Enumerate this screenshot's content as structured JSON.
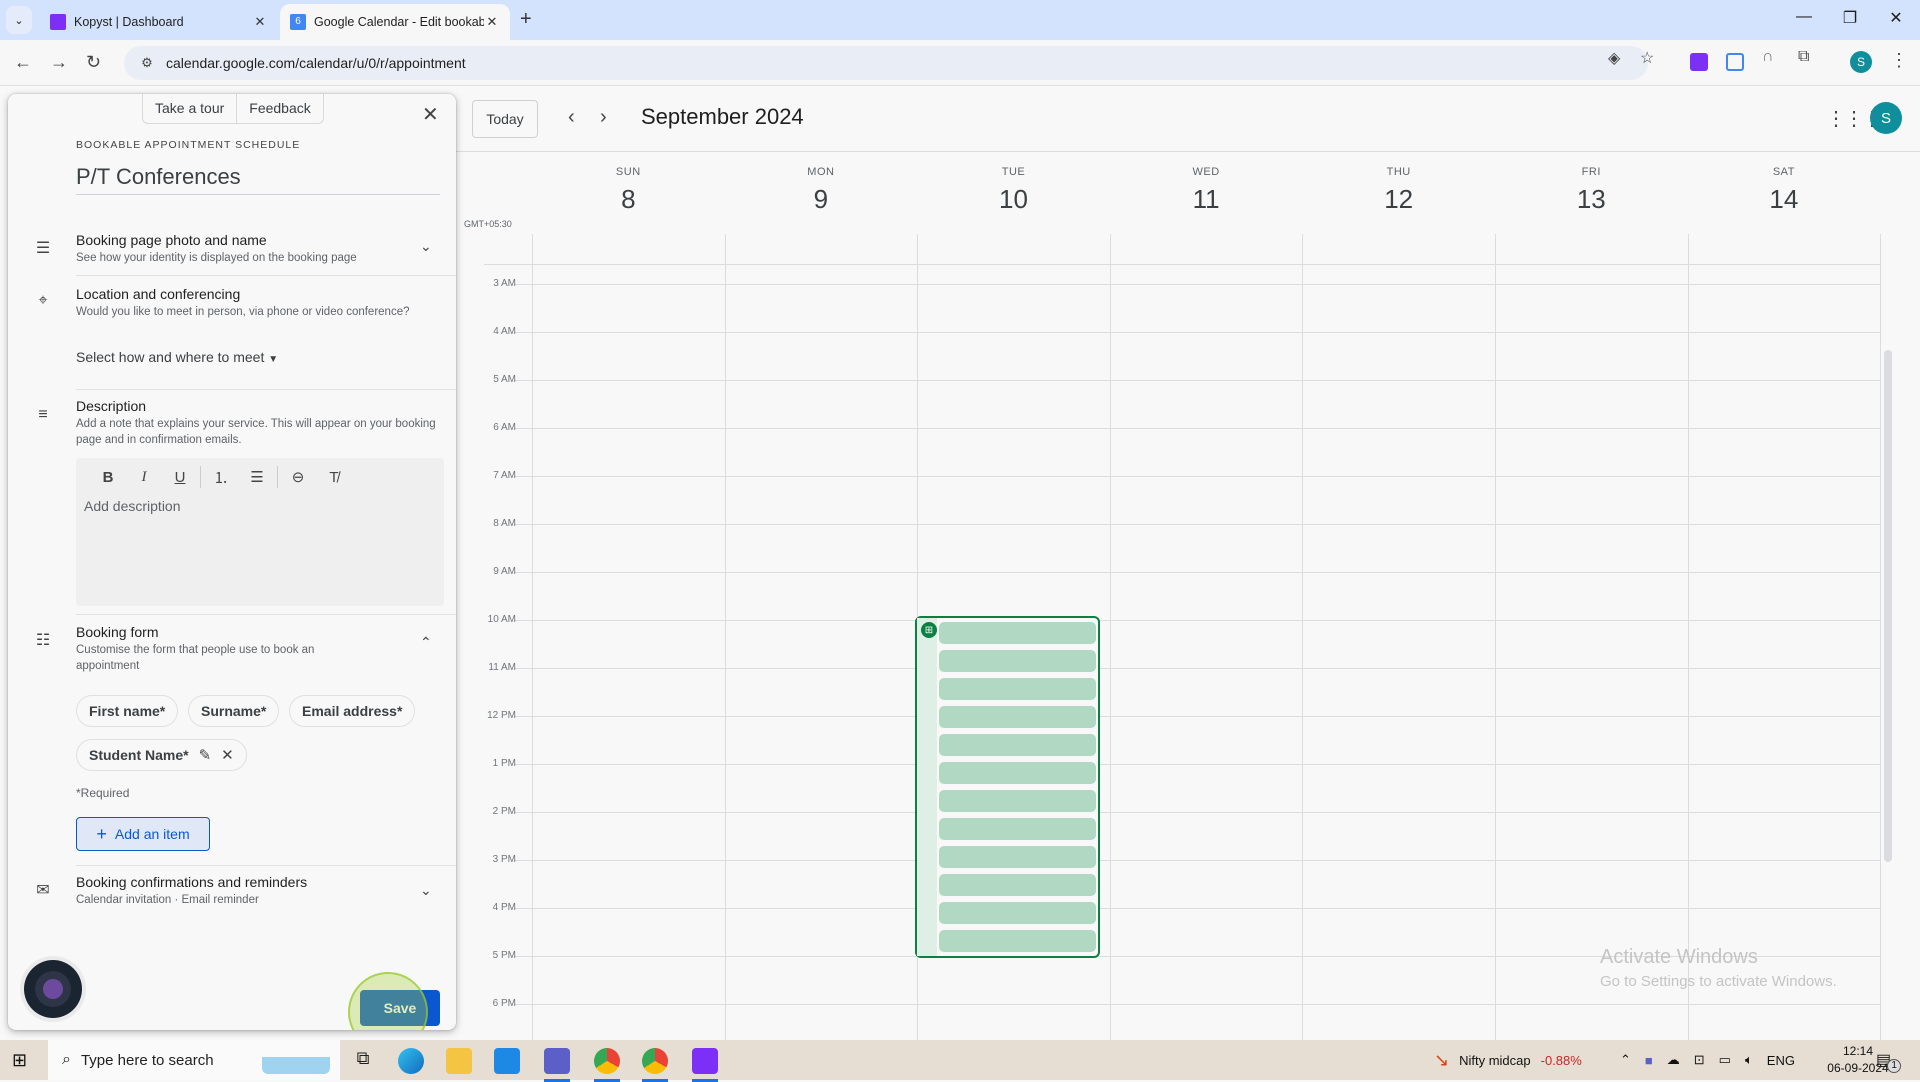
{
  "browser": {
    "tabs": [
      {
        "title": "Kopyst | Dashboard",
        "active": false,
        "favicon_color": "#7b2ff7"
      },
      {
        "title": "Google Calendar - Edit bookabl",
        "active": true,
        "favicon_color": "#4285f4"
      }
    ],
    "new_tab": "+",
    "url": "calendar.google.com/calendar/u/0/r/appointment",
    "profile_initial": "S"
  },
  "panel": {
    "tour_label": "Take a tour",
    "feedback_label": "Feedback",
    "eyebrow": "BOOKABLE APPOINTMENT SCHEDULE",
    "title": "P/T Conferences",
    "sections": {
      "booking_page": {
        "title": "Booking page photo and name",
        "subtitle": "See how your identity is displayed on the booking page"
      },
      "location": {
        "title": "Location and conferencing",
        "subtitle": "Would you like to meet in person, via phone or video conference?",
        "select_label": "Select how and where to meet"
      },
      "description": {
        "title": "Description",
        "subtitle": "Add a note that explains your service. This will appear on your booking page and in confirmation emails.",
        "placeholder": "Add description"
      },
      "booking_form": {
        "title": "Booking form",
        "subtitle": "Customise the form that people use to book an appointment",
        "fields": [
          "First name*",
          "Surname*",
          "Email address*"
        ],
        "custom_field": "Student Name*",
        "required_note": "*Required",
        "add_item_label": "Add an item"
      },
      "confirmations": {
        "title": "Booking confirmations and reminders",
        "subtitle": "Calendar invitation · Email reminder"
      }
    },
    "save_label": "Save"
  },
  "calendar": {
    "today_label": "Today",
    "month_label": "September 2024",
    "timezone": "GMT+05:30",
    "days": [
      {
        "name": "SUN",
        "date": "8"
      },
      {
        "name": "MON",
        "date": "9"
      },
      {
        "name": "TUE",
        "date": "10"
      },
      {
        "name": "WED",
        "date": "11"
      },
      {
        "name": "THU",
        "date": "12"
      },
      {
        "name": "FRI",
        "date": "13"
      },
      {
        "name": "SAT",
        "date": "14"
      }
    ],
    "hours": [
      "3 AM",
      "4 AM",
      "5 AM",
      "6 AM",
      "7 AM",
      "8 AM",
      "9 AM",
      "10 AM",
      "11 AM",
      "12 PM",
      "1 PM",
      "2 PM",
      "3 PM",
      "4 PM",
      "5 PM",
      "6 PM"
    ],
    "availability_block": {
      "day": "TUE 10",
      "start": "10 AM",
      "end": "5 PM",
      "slot_count": 12,
      "color": "#0b8043",
      "slot_color": "#b1d8c3"
    },
    "avatar_initial": "S"
  },
  "watermark": {
    "title": "Activate Windows",
    "subtitle": "Go to Settings to activate Windows."
  },
  "taskbar": {
    "search_placeholder": "Type here to search",
    "ticker_name": "Nifty midcap",
    "ticker_change": "-0.88%",
    "language": "ENG",
    "time": "12:14",
    "date": "06-09-2024",
    "notification_count": "1"
  }
}
